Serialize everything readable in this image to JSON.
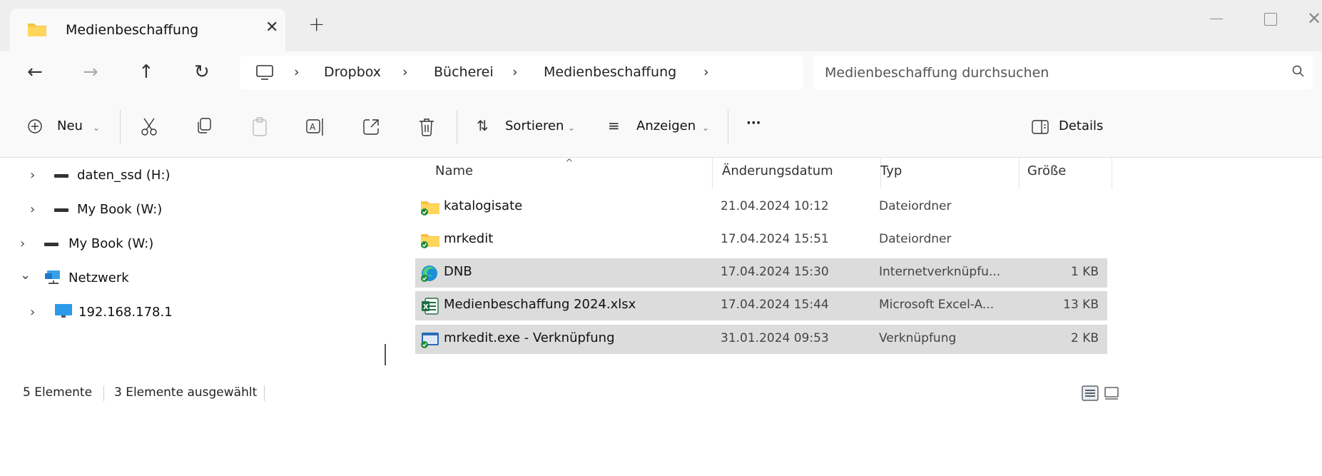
{
  "tab": {
    "title": "Medienbeschaffung",
    "close": "✕",
    "new": "+"
  },
  "window": {
    "close": "✕"
  },
  "nav": {
    "back": "←",
    "forward": "→",
    "up": "↑",
    "refresh": "↻"
  },
  "breadcrumb": {
    "items": [
      "Dropbox",
      "Bücherei",
      "Medienbeschaffung"
    ],
    "separator": "›"
  },
  "search": {
    "placeholder": "Medienbeschaffung durchsuchen"
  },
  "toolbar": {
    "new_label": "Neu",
    "sort_label": "Sortieren",
    "view_label": "Anzeigen",
    "more_label": "···",
    "details_label": "Details"
  },
  "navpane": {
    "items": [
      {
        "label": "daten_ssd (H:)",
        "chevron": "›"
      },
      {
        "label": "My Book (W:)",
        "chevron": "›"
      },
      {
        "label": "My Book (W:)",
        "chevron": "›"
      },
      {
        "label": "Netzwerk",
        "chevron": "⌄"
      },
      {
        "label": "192.168.178.1",
        "chevron": "›"
      }
    ]
  },
  "columns": {
    "name": "Name",
    "date": "Änderungsdatum",
    "type": "Typ",
    "size": "Größe",
    "sort_caret": "^"
  },
  "files": [
    {
      "name": "katalogisate",
      "date": "21.04.2024 10:12",
      "type": "Dateiordner",
      "size": "",
      "icon": "folder-sync-icon",
      "selected": false
    },
    {
      "name": "mrkedit",
      "date": "17.04.2024 15:51",
      "type": "Dateiordner",
      "size": "",
      "icon": "folder-sync-icon",
      "selected": false
    },
    {
      "name": "DNB",
      "date": "17.04.2024 15:30",
      "type": "Internetverknüpfu...",
      "size": "1 KB",
      "icon": "edge-link-icon",
      "selected": true
    },
    {
      "name": "Medienbeschaffung 2024.xlsx",
      "date": "17.04.2024 15:44",
      "type": "Microsoft Excel-A...",
      "size": "13 KB",
      "icon": "excel-file-icon",
      "selected": true
    },
    {
      "name": "mrkedit.exe - Verknüpfung",
      "date": "31.01.2024 09:53",
      "type": "Verknüpfung",
      "size": "2 KB",
      "icon": "shortcut-icon",
      "selected": true
    }
  ],
  "status": {
    "count": "5 Elemente",
    "selected": "3 Elemente ausgewählt"
  },
  "colors": {
    "accent": "#0067c0",
    "selection": "#dcdcdc",
    "folder": "#f6c343",
    "sync": "#1f8a3a"
  }
}
